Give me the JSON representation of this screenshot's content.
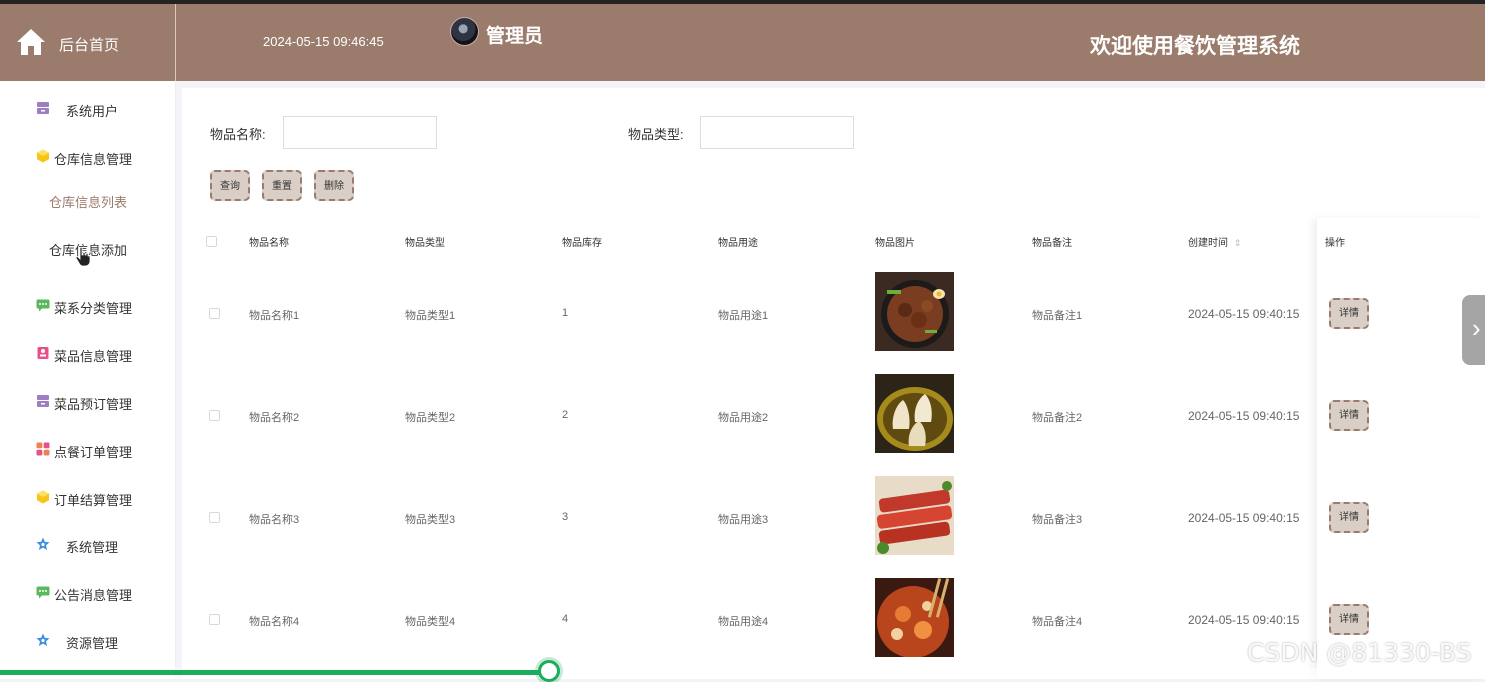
{
  "header": {
    "home_label": "后台首页",
    "datetime": "2024-05-15 09:46:45",
    "user_name": "管理员",
    "welcome": "欢迎使用餐饮管理系统",
    "bg_color": "#9a7b6c"
  },
  "sidebar": {
    "items": [
      {
        "label": "系统用户",
        "icon": "archive-icon",
        "color": "#9b7fc0"
      },
      {
        "label": "仓库信息管理",
        "icon": "cube-icon",
        "color": "#f5c518"
      },
      {
        "label": "仓库信息列表",
        "type": "submenu",
        "active": true
      },
      {
        "label": "仓库信息添加",
        "type": "submenu"
      },
      {
        "label": "菜系分类管理",
        "icon": "chat-icon",
        "color": "#5cb85c"
      },
      {
        "label": "菜品信息管理",
        "icon": "badge-icon",
        "color": "#e8508a"
      },
      {
        "label": "菜品预订管理",
        "icon": "archive-icon",
        "color": "#9b7fc0"
      },
      {
        "label": "点餐订单管理",
        "icon": "grid-icon",
        "color": "#f08050"
      },
      {
        "label": "订单结算管理",
        "icon": "cube-icon",
        "color": "#f5c518"
      },
      {
        "label": "系统管理",
        "icon": "star-icon",
        "color": "#3a8ee6"
      },
      {
        "label": "公告消息管理",
        "icon": "chat-icon",
        "color": "#5cb85c"
      },
      {
        "label": "资源管理",
        "icon": "star-icon",
        "color": "#3a8ee6"
      }
    ]
  },
  "search": {
    "name_label": "物品名称:",
    "name_value": "",
    "type_label": "物品类型:",
    "type_value": "",
    "query_btn": "查询",
    "reset_btn": "重置",
    "delete_btn": "删除"
  },
  "table": {
    "headers": [
      "物品名称",
      "物品类型",
      "物品库存",
      "物品用途",
      "物品图片",
      "物品备注",
      "创建时间",
      "操作"
    ],
    "detail_label": "详情",
    "rows": [
      {
        "name": "物品名称1",
        "type": "物品类型1",
        "stock": "1",
        "use": "物品用途1",
        "image": "food-noodles",
        "remark": "物品备注1",
        "created": "2024-05-15 09:40:15"
      },
      {
        "name": "物品名称2",
        "type": "物品类型2",
        "stock": "2",
        "use": "物品用途2",
        "image": "food-dumplings",
        "remark": "物品备注2",
        "created": "2024-05-15 09:40:15"
      },
      {
        "name": "物品名称3",
        "type": "物品类型3",
        "stock": "3",
        "use": "物品用途3",
        "image": "food-skewers",
        "remark": "物品备注3",
        "created": "2024-05-15 09:40:15"
      },
      {
        "name": "物品名称4",
        "type": "物品类型4",
        "stock": "4",
        "use": "物品用途4",
        "image": "food-hotpot",
        "remark": "物品备注4",
        "created": "2024-05-15 09:40:15"
      }
    ]
  },
  "video": {
    "progress": 0.37,
    "watermark": "CSDN @81330-BS"
  }
}
